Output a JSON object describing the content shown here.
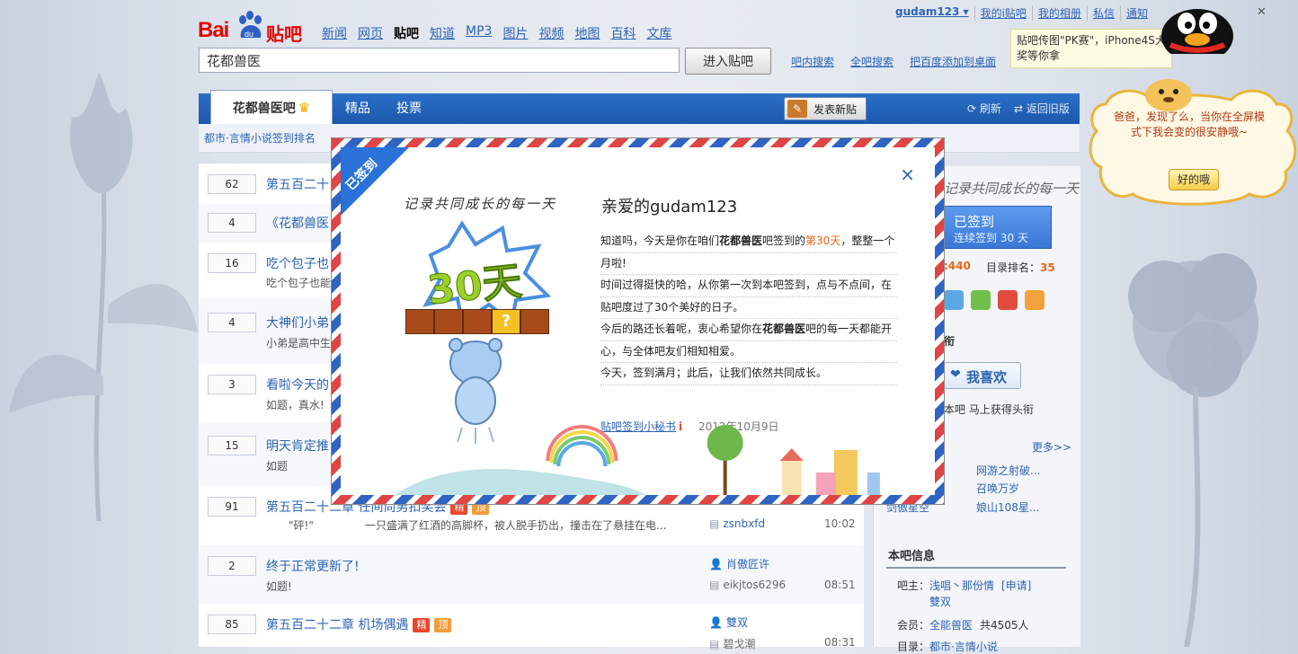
{
  "header": {
    "logo_bai": "Bai",
    "logo_du": "du",
    "logo_tieba": "贴吧",
    "nav": [
      "新闻",
      "网页",
      "贴吧",
      "知道",
      "MP3",
      "图片",
      "视频",
      "地图",
      "百科",
      "文库"
    ],
    "nav_current": "贴吧",
    "search_value": "花都兽医",
    "enter_button": "进入贴吧",
    "sublinks": [
      "吧内搜索",
      "全吧搜索",
      "把百度添加到桌面"
    ]
  },
  "userbar": {
    "username": "gudam123 ▾",
    "links": [
      "我的i贴吧",
      "我的相册",
      "私信",
      "通知"
    ]
  },
  "pk_tip": {
    "text": "贴吧传图\"PK赛\"，iPhone4S大奖等你拿",
    "close": "×"
  },
  "tabs": {
    "active": "花都兽医吧",
    "crown": "♛",
    "others": [
      "精品",
      "投票"
    ],
    "post_button": "发表新贴",
    "refresh": "⟳ 刷新",
    "old_version": "⇄ 返回旧版"
  },
  "infostrip": "都市·言情小说签到排名",
  "threads": [
    {
      "count": "62",
      "title": "第五百二十",
      "excerpt": "",
      "author": "",
      "time": ""
    },
    {
      "count": "4",
      "title": "《花都兽医",
      "excerpt": "",
      "author": "",
      "time": ""
    },
    {
      "count": "16",
      "title": "吃个包子也",
      "excerpt": "吃个包子也能",
      "author": "",
      "time": ""
    },
    {
      "count": "4",
      "title": "大神们小弟",
      "excerpt": "小弟是高中生",
      "author": "",
      "time": ""
    },
    {
      "count": "3",
      "title": "看啦今天的",
      "excerpt": "如题，真水!",
      "author": "",
      "time": ""
    },
    {
      "count": "15",
      "title": "明天肯定推",
      "excerpt": "如题",
      "author": "",
      "time": ""
    },
    {
      "count": "91",
      "title": "第五百二十二章 任间尚男扣奖会",
      "badges": [
        "精",
        "顶"
      ],
      "excerpt": "\"砰!\"",
      "excerpt2": "一只盛满了红酒的高脚杯，被人脱手扔出，撞击在了悬挂在电...",
      "author": "zsnbxfd",
      "time": "10:02"
    },
    {
      "count": "2",
      "title": "终于正常更新了!",
      "excerpt": "如题!",
      "author": "肖傲匠许",
      "author2": "eikjtos6296",
      "time": "08:51"
    },
    {
      "count": "85",
      "title": "第五百二十二章 机场偶遇",
      "badges": [
        "精",
        "顶"
      ],
      "excerpt": "",
      "author": "雙双",
      "author2": "碧戈潮",
      "time": "08:31"
    }
  ],
  "sidebar": {
    "hand_title": "记录共同成长的每一天",
    "signed_btn": "已签到",
    "signed_sub": "连续签到 30 天",
    "rank_a": ":440",
    "rank_b_label": "目录排名：",
    "rank_b": "35",
    "section_fan": "衔",
    "like_btn": "我喜欢",
    "like_sub": "本吧  马上获得头衔",
    "more": "更多>>",
    "links": [
      "网游之射破...",
      "召唤万岁",
      "娘山108星..."
    ],
    "link_left": "剑傲星空",
    "info_title": "本吧信息",
    "owner_label": "吧主：",
    "owner_names": "浅唱丶那份情",
    "apply": "[申请]",
    "owner2": "雙双",
    "member_label": "会员：",
    "member_name": "全能兽医",
    "member_count": "共4505人",
    "dir_label": "目录：",
    "dir_value": "都市·言情小说"
  },
  "modal": {
    "ribbon": "已签到",
    "close": "×",
    "hand_title": "记录共同成长的每一天",
    "days": "30天",
    "greeting": "亲爱的gudam123",
    "lines": [
      [
        "知道吗，今天是你在咱们",
        "花都兽医",
        "吧签到的",
        "第30天",
        "，整整一个"
      ],
      [
        "月啦!"
      ],
      [
        "时间过得挺快的哈，从你第一次到本吧签到，点与不点间，在"
      ],
      [
        "贴吧度过了30个美好的日子。"
      ],
      [
        "今后的路还长着呢，衷心希望你在",
        "花都兽医",
        "吧的每一天都能开"
      ],
      [
        "心，与全体吧友们相知相爱。"
      ],
      [
        "今天，签到满月；此后，让我们依然共同成长。"
      ]
    ],
    "signature": "贴吧签到小秘书",
    "date": "2012年10月9日"
  },
  "pet": {
    "text": "爸爸，发现了么，当你在全屏模式下我会变的很安静哦~",
    "ok": "好的哦"
  },
  "colors": {
    "brand_blue": "#1c58ab",
    "baidu_red": "#e10602",
    "link": "#2d64b3",
    "highlight": "#e5661a"
  }
}
